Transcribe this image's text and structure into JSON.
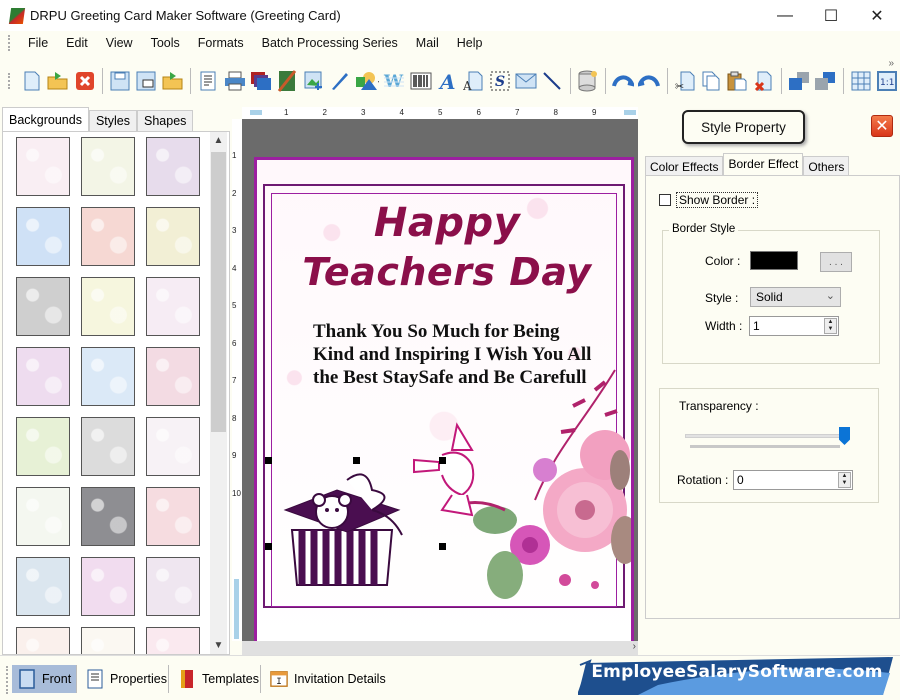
{
  "window": {
    "title": "DRPU Greeting Card Maker Software (Greeting Card)",
    "controls": {
      "minimize": "—",
      "maximize": "☐",
      "close": "✕"
    }
  },
  "menu": [
    "File",
    "Edit",
    "View",
    "Tools",
    "Formats",
    "Batch Processing Series",
    "Mail",
    "Help"
  ],
  "toolbar": {
    "buttons": [
      {
        "name": "new",
        "glyph": "🗋"
      },
      {
        "name": "open",
        "glyph": "📂"
      },
      {
        "name": "close",
        "glyph": "✖"
      },
      {
        "name": "save",
        "glyph": "💾"
      },
      {
        "name": "save-as",
        "glyph": "💾"
      },
      {
        "name": "open-template",
        "glyph": "📂"
      },
      {
        "name": "properties",
        "glyph": "📄"
      },
      {
        "name": "print",
        "glyph": "🖶"
      },
      {
        "name": "background",
        "glyph": "▦"
      },
      {
        "name": "image-crop",
        "glyph": "◩"
      },
      {
        "name": "insert-image",
        "glyph": "🖼"
      },
      {
        "name": "pencil",
        "glyph": "✒"
      },
      {
        "name": "shapes",
        "glyph": "⬟"
      },
      {
        "name": "word-art",
        "glyph": "W"
      },
      {
        "name": "barcode",
        "glyph": "▥"
      },
      {
        "name": "text",
        "glyph": "A"
      },
      {
        "name": "text-style",
        "glyph": "Ą"
      },
      {
        "name": "signature",
        "glyph": "S"
      },
      {
        "name": "mail",
        "glyph": "✉"
      },
      {
        "name": "line",
        "glyph": "╲"
      },
      {
        "name": "database",
        "glyph": "🛢"
      },
      {
        "name": "undo",
        "glyph": "↶"
      },
      {
        "name": "redo",
        "glyph": "↷"
      },
      {
        "name": "cut",
        "glyph": "✂"
      },
      {
        "name": "copy",
        "glyph": "⎘"
      },
      {
        "name": "paste",
        "glyph": "📋"
      },
      {
        "name": "delete",
        "glyph": "✗"
      },
      {
        "name": "bring-front",
        "glyph": "◧"
      },
      {
        "name": "send-back",
        "glyph": "◨"
      },
      {
        "name": "grid",
        "glyph": "▦"
      },
      {
        "name": "actual-size",
        "glyph": "1:1"
      }
    ],
    "overflow": "»"
  },
  "left_panel": {
    "tabs": [
      "Backgrounds",
      "Styles",
      "Shapes"
    ],
    "active_tab": "Backgrounds",
    "thumbnails": [
      {
        "name": "pastel-doodles",
        "color": "#f9eef3"
      },
      {
        "name": "baby-items",
        "color": "#f3f5e6"
      },
      {
        "name": "lavender-flowers",
        "color": "#e7dcec"
      },
      {
        "name": "clouds",
        "color": "#cfe1f6"
      },
      {
        "name": "strawberries",
        "color": "#f6d8d3"
      },
      {
        "name": "leaves",
        "color": "#f2efd5"
      },
      {
        "name": "grey-leaves",
        "color": "#cfcfcf"
      },
      {
        "name": "flower-strip",
        "color": "#f6f6de"
      },
      {
        "name": "gift-boxes",
        "color": "#f6ecf4"
      },
      {
        "name": "colorful-flowers",
        "color": "#eedcef"
      },
      {
        "name": "snowflakes",
        "color": "#dbe9f7"
      },
      {
        "name": "circle-flowers",
        "color": "#f3dbe3"
      },
      {
        "name": "christmas-trees",
        "color": "#e7f1d6"
      },
      {
        "name": "heart-silver",
        "color": "#dcdcdc"
      },
      {
        "name": "birthday-text",
        "color": "#f7f2f6"
      },
      {
        "name": "green-hearts",
        "color": "#f4f7f0"
      },
      {
        "name": "bokeh-lights",
        "color": "#8e8e92"
      },
      {
        "name": "red-hearts",
        "color": "#f6dce0"
      },
      {
        "name": "santa",
        "color": "#dbe6ef"
      },
      {
        "name": "pink-bubbles",
        "color": "#f1dcef"
      },
      {
        "name": "butterflies",
        "color": "#efe6f0"
      },
      {
        "name": "stripes",
        "color": "#faf0ec"
      },
      {
        "name": "teddy",
        "color": "#fbf8f2"
      },
      {
        "name": "pink-pattern",
        "color": "#fae9ef"
      }
    ],
    "scroll_up": "^",
    "scroll_down": "v"
  },
  "rulers": {
    "horizontal": [
      "1",
      "2",
      "3",
      "4",
      "5",
      "6",
      "7",
      "8",
      "9"
    ],
    "vertical": [
      "1",
      "2",
      "3",
      "4",
      "5",
      "6",
      "7",
      "8",
      "9",
      "10"
    ]
  },
  "card": {
    "title_line1": "Happy",
    "title_line2": "Teachers Day",
    "message": "Thank You So Much for Being Kind and Inspiring I Wish You All the Best StaySafe and Be Carefull",
    "title_color": "#8b0f4a",
    "border_color": "#9c1fa0"
  },
  "right_panel": {
    "title": "Style Property",
    "close_glyph": "✕",
    "tabs": [
      "Color Effects",
      "Border Effect",
      "Others"
    ],
    "active_tab": "Border Effect",
    "show_border": {
      "label": "Show Border :",
      "checked": false
    },
    "border_style": {
      "legend": "Border Style",
      "color_label": "Color :",
      "color_value": "#000000",
      "color_button": ". . .",
      "style_label": "Style :",
      "style_value": "Solid",
      "width_label": "Width :",
      "width_value": "1"
    },
    "transparency": {
      "label": "Transparency :",
      "value_percent": 100
    },
    "rotation": {
      "label": "Rotation :",
      "value": "0"
    }
  },
  "bottom_tabs": [
    {
      "label": "Front",
      "active": true
    },
    {
      "label": "Properties",
      "active": false
    },
    {
      "label": "Templates",
      "active": false
    },
    {
      "label": "Invitation Details",
      "active": false
    }
  ],
  "brand": {
    "text": "EmployeeSalarySoftware.com"
  }
}
